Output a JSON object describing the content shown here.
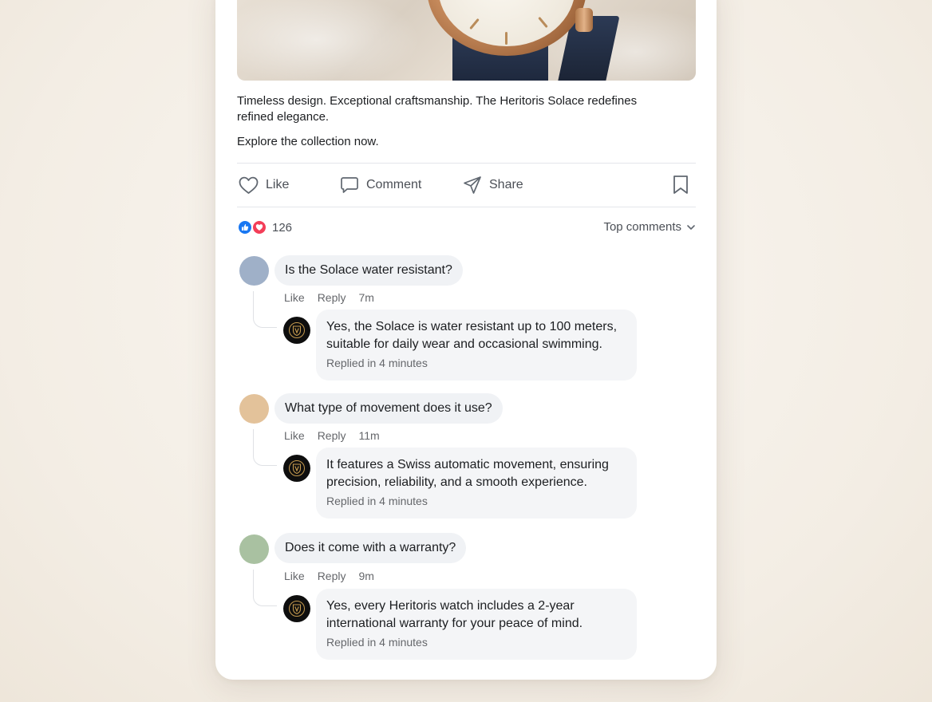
{
  "post": {
    "caption": "Timeless design. Exceptional craftsmanship. The Heritoris Solace redefines refined elegance.",
    "cta": "Explore the collection now."
  },
  "actions": {
    "like": "Like",
    "comment": "Comment",
    "share": "Share"
  },
  "reactions": {
    "count": "126"
  },
  "sort": {
    "label": "Top comments"
  },
  "comments": [
    {
      "text": "Is the Solace water resistant?",
      "like": "Like",
      "reply": "Reply",
      "time": "7m",
      "avatar_color": "#9fb0c8",
      "response": {
        "text": "Yes, the Solace is water resistant up to 100 meters, suitable for daily wear and occasional swimming.",
        "status": "Replied in 4 minutes"
      }
    },
    {
      "text": "What type of movement does it use?",
      "like": "Like",
      "reply": "Reply",
      "time": "11m",
      "avatar_color": "#e3c29a",
      "response": {
        "text": "It features a Swiss automatic movement, ensuring precision, reliability, and a smooth experience.",
        "status": "Replied in 4 minutes"
      }
    },
    {
      "text": "Does it come with a warranty?",
      "like": "Like",
      "reply": "Reply",
      "time": "9m",
      "avatar_color": "#a9c1a1",
      "response": {
        "text": "Yes, every Heritoris watch includes a 2-year international warranty for your peace of mind.",
        "status": "Replied in 4 minutes"
      }
    }
  ]
}
